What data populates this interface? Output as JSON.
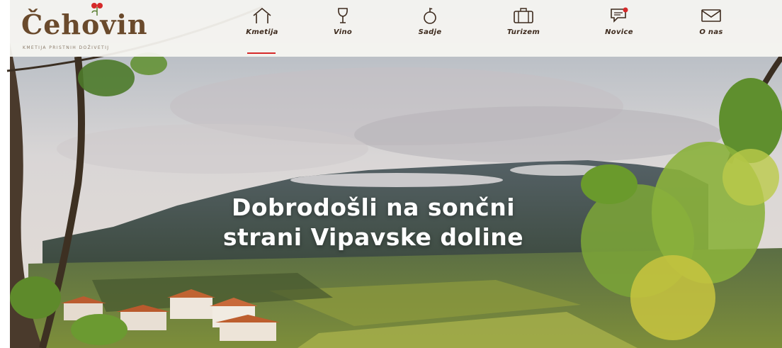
{
  "brand": {
    "name": "Čehovin",
    "tagline": "KMETIJA PRISTNIH DOŽIVETIJ",
    "color": "#6a4a2c",
    "accent": "#d52a2a"
  },
  "nav": {
    "items": [
      {
        "label": "Kmetija",
        "icon": "house-icon",
        "active": true
      },
      {
        "label": "Vino",
        "icon": "wine-glass-icon",
        "active": false
      },
      {
        "label": "Sadje",
        "icon": "apple-icon",
        "active": false
      },
      {
        "label": "Turizem",
        "icon": "suitcase-icon",
        "active": false
      },
      {
        "label": "Novice",
        "icon": "chat-bubble-icon",
        "active": false
      },
      {
        "label": "O nas",
        "icon": "envelope-icon",
        "active": false
      }
    ]
  },
  "hero": {
    "headline_line1": "Dobrodošli na sončni",
    "headline_line2": "strani Vipavske doline"
  }
}
